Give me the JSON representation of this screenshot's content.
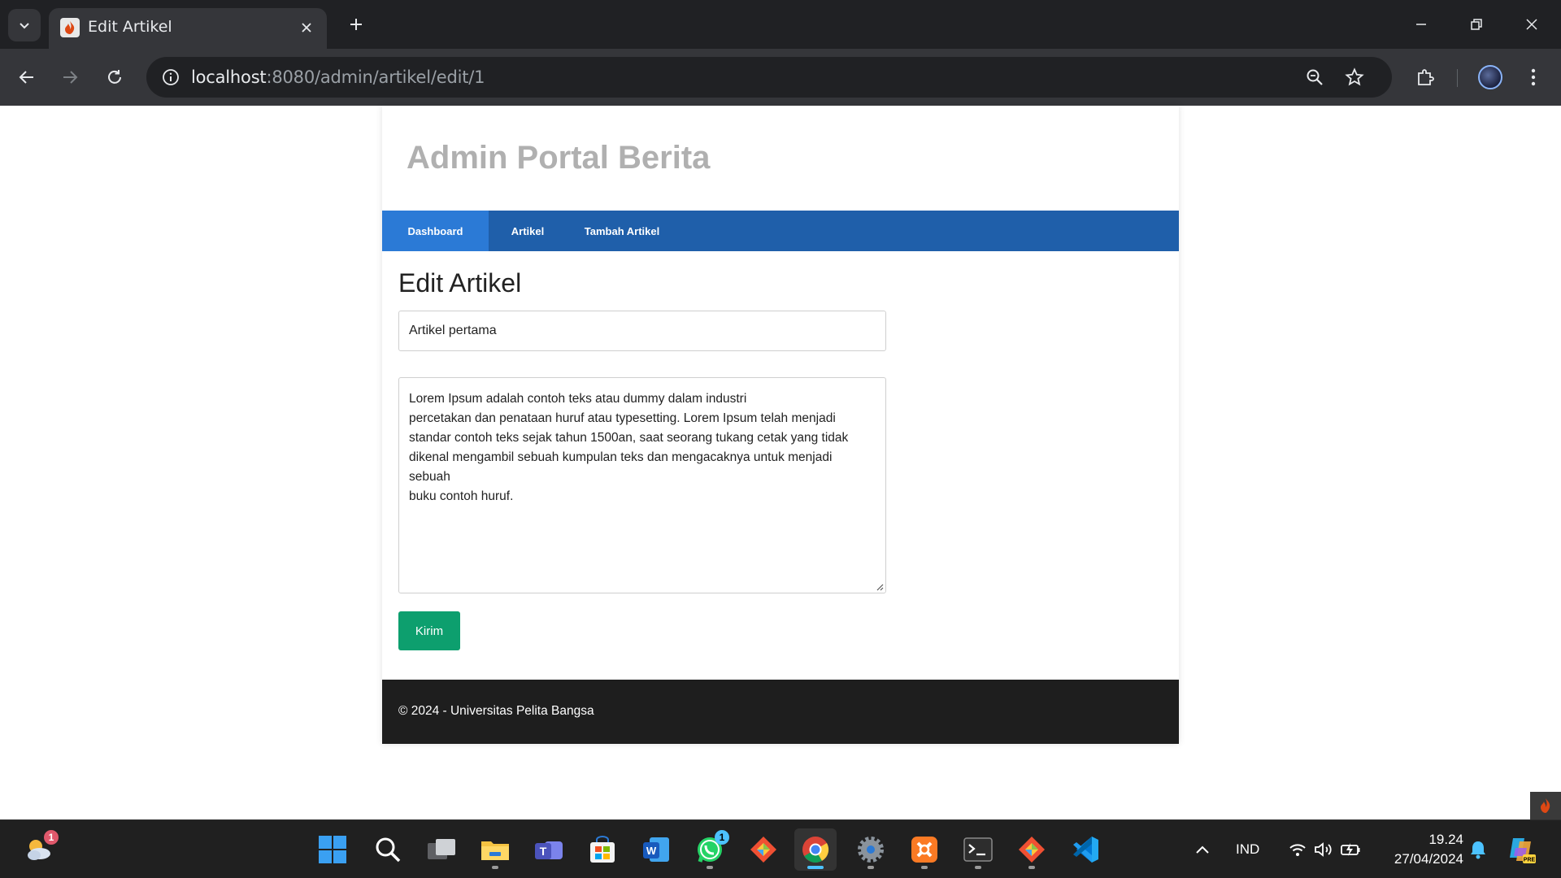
{
  "browser": {
    "tab_title": "Edit Artikel",
    "url_host": "localhost",
    "url_rest": ":8080/admin/artikel/edit/1"
  },
  "site": {
    "title": "Admin Portal Berita",
    "nav": [
      {
        "label": "Dashboard",
        "active": true
      },
      {
        "label": "Artikel",
        "active": false
      },
      {
        "label": "Tambah Artikel",
        "active": false
      }
    ]
  },
  "form": {
    "heading": "Edit Artikel",
    "title_value": "Artikel pertama",
    "body_value": "Lorem Ipsum adalah contoh teks atau dummy dalam industri\npercetakan dan penataan huruf atau typesetting. Lorem Ipsum telah menjadi standar contoh teks sejak tahun 1500an, saat seorang tukang cetak yang tidak dikenal mengambil sebuah kumpulan teks dan mengacaknya untuk menjadi sebuah\nbuku contoh huruf.",
    "submit_label": "Kirim"
  },
  "footer": {
    "text": "© 2024 - Universitas Pelita Bangsa"
  },
  "taskbar": {
    "weather_badge": "1",
    "whatsapp_badge": "1",
    "language": "IND",
    "time": "19.24",
    "date": "27/04/2024"
  },
  "colors": {
    "navbar": "#1f5faa",
    "nav_active": "#2b7ad6",
    "submit": "#0d9f6e",
    "footer": "#1e1e1e",
    "title_gray": "#b0b0b0"
  }
}
